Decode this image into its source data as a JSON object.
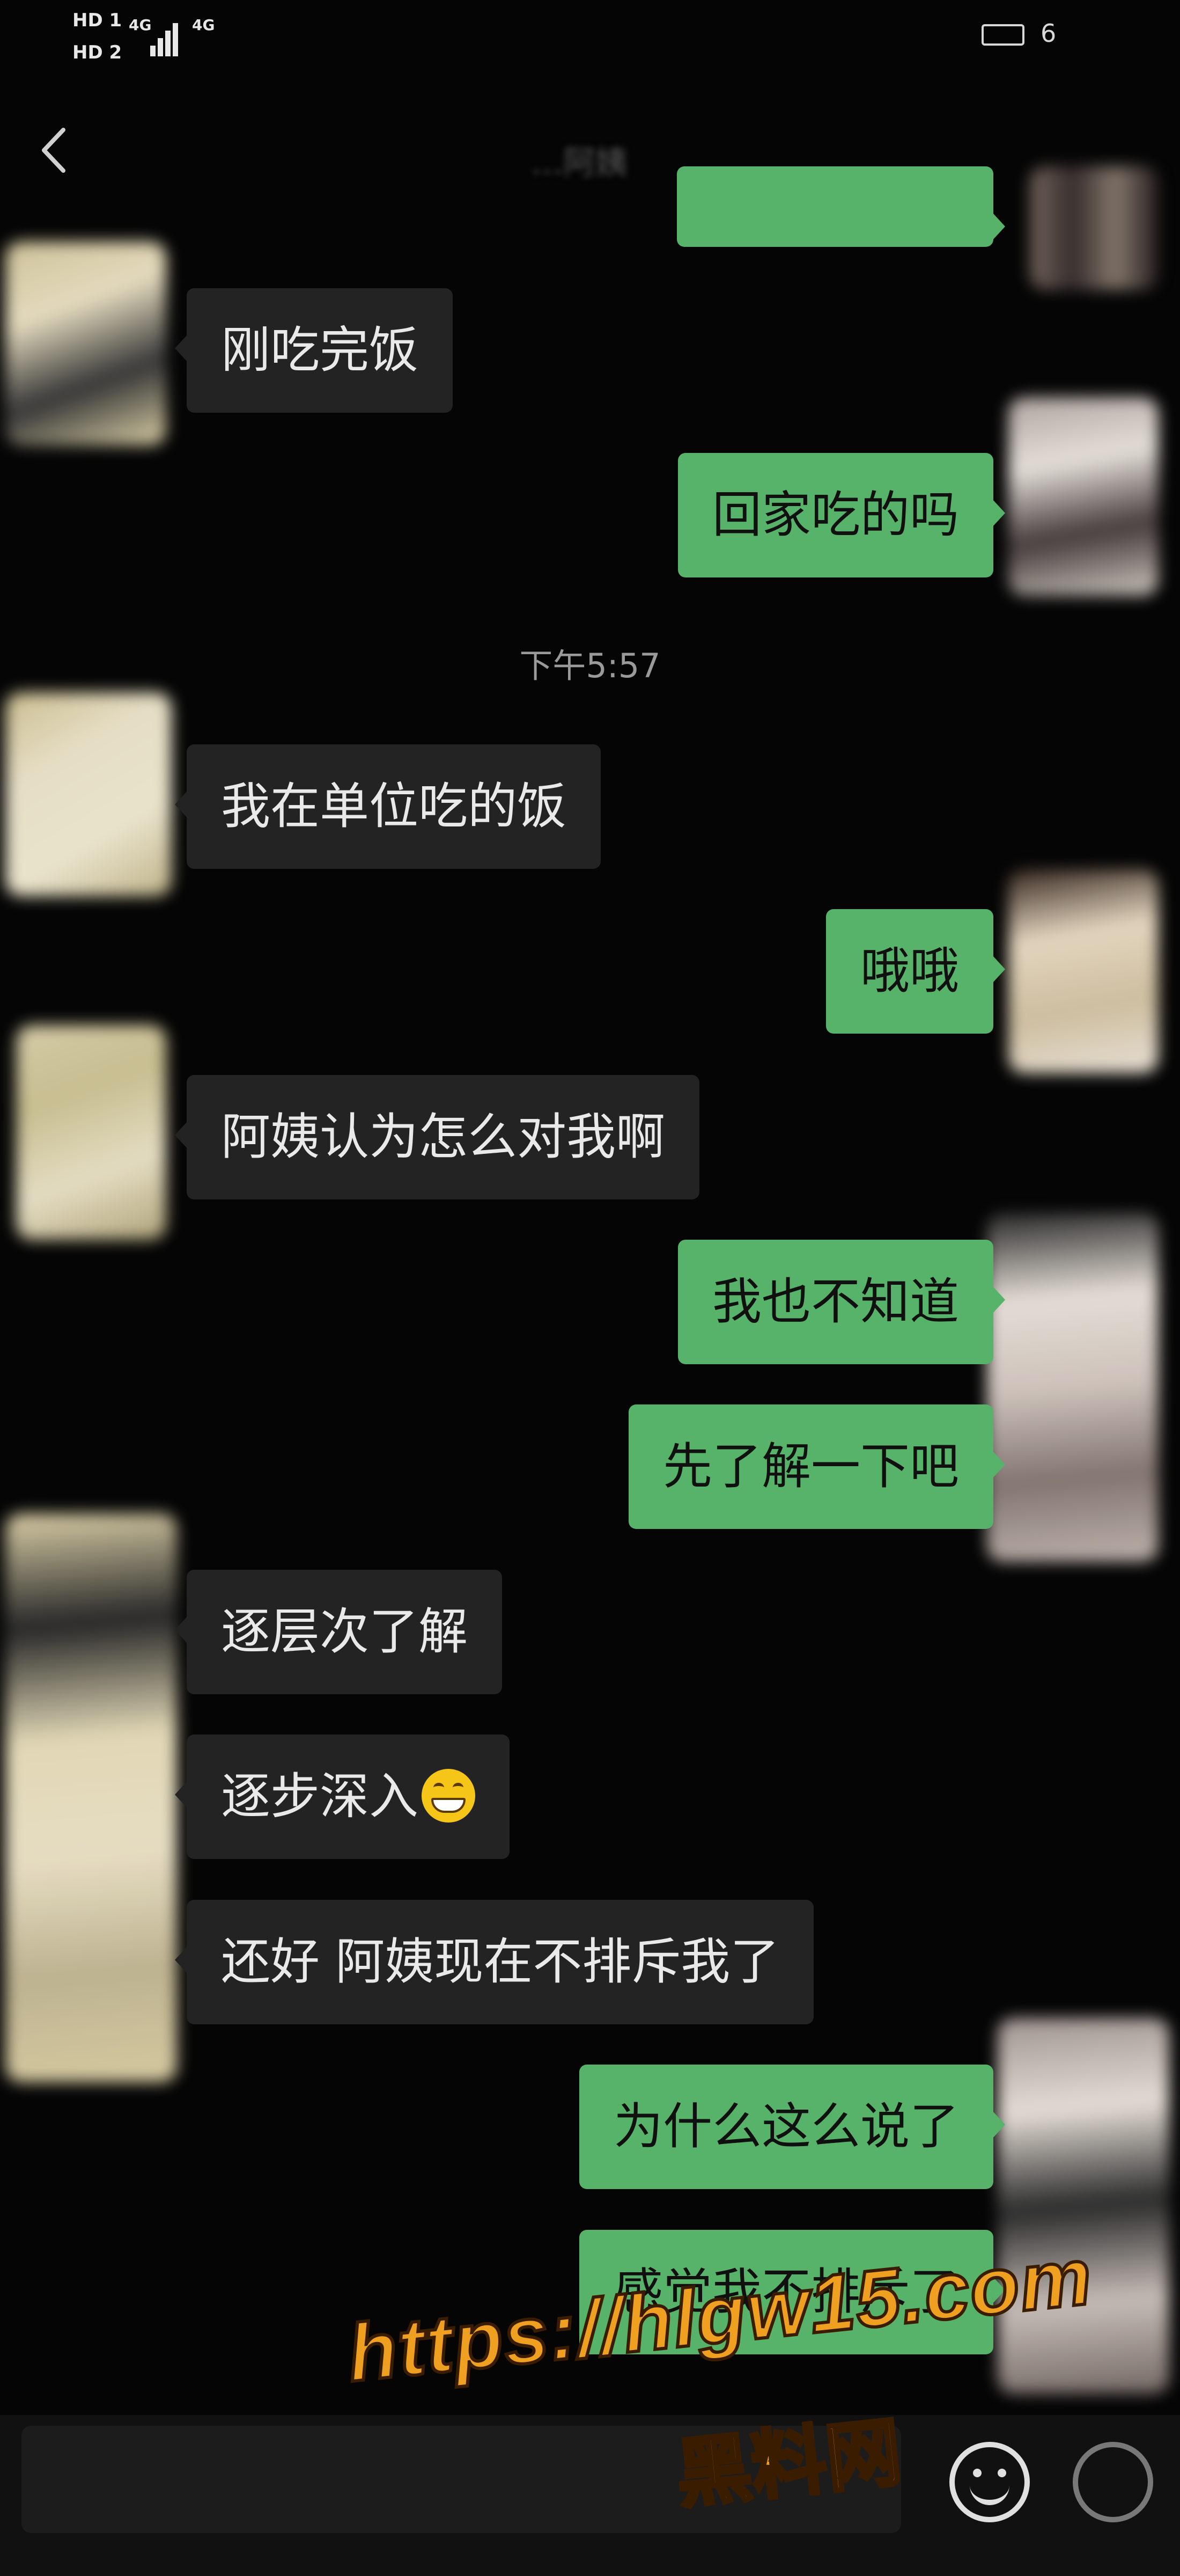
{
  "status_bar": {
    "sim1": "HD 1",
    "sim2": "HD 2",
    "net1": "4G",
    "net2": "4G",
    "battery_text": "6"
  },
  "header": {
    "back_icon": "chevron-left-icon",
    "title": "…阿姨"
  },
  "timestamp": "下午5:57",
  "messages": [
    {
      "side": "out",
      "text": ""
    },
    {
      "side": "in",
      "text": "刚吃完饭"
    },
    {
      "side": "out",
      "text": "回家吃的吗"
    },
    {
      "side": "in",
      "text": "我在单位吃的饭"
    },
    {
      "side": "out",
      "text": "哦哦"
    },
    {
      "side": "in",
      "text": "阿姨认为怎么对我啊"
    },
    {
      "side": "out",
      "text": "我也不知道"
    },
    {
      "side": "out",
      "text": "先了解一下吧"
    },
    {
      "side": "in",
      "text": "逐层次了解"
    },
    {
      "side": "in",
      "text": "逐步深入",
      "emoji": "grinning-face-icon"
    },
    {
      "side": "in",
      "text": "还好  阿姨现在不排斥我了"
    },
    {
      "side": "out",
      "text": "为什么这么说了"
    },
    {
      "side": "out",
      "text": "感觉我不排斥了"
    }
  ],
  "input_bar": {
    "emoji_icon": "smiley-icon",
    "plus_icon": "plus-circle-icon"
  },
  "watermark": {
    "url": "https://hlgw15.com",
    "name": "黑料网"
  },
  "colors": {
    "background": "#050505",
    "incoming_bubble": "#232323",
    "outgoing_bubble": "#57b26a",
    "watermark": "#f0a020"
  }
}
